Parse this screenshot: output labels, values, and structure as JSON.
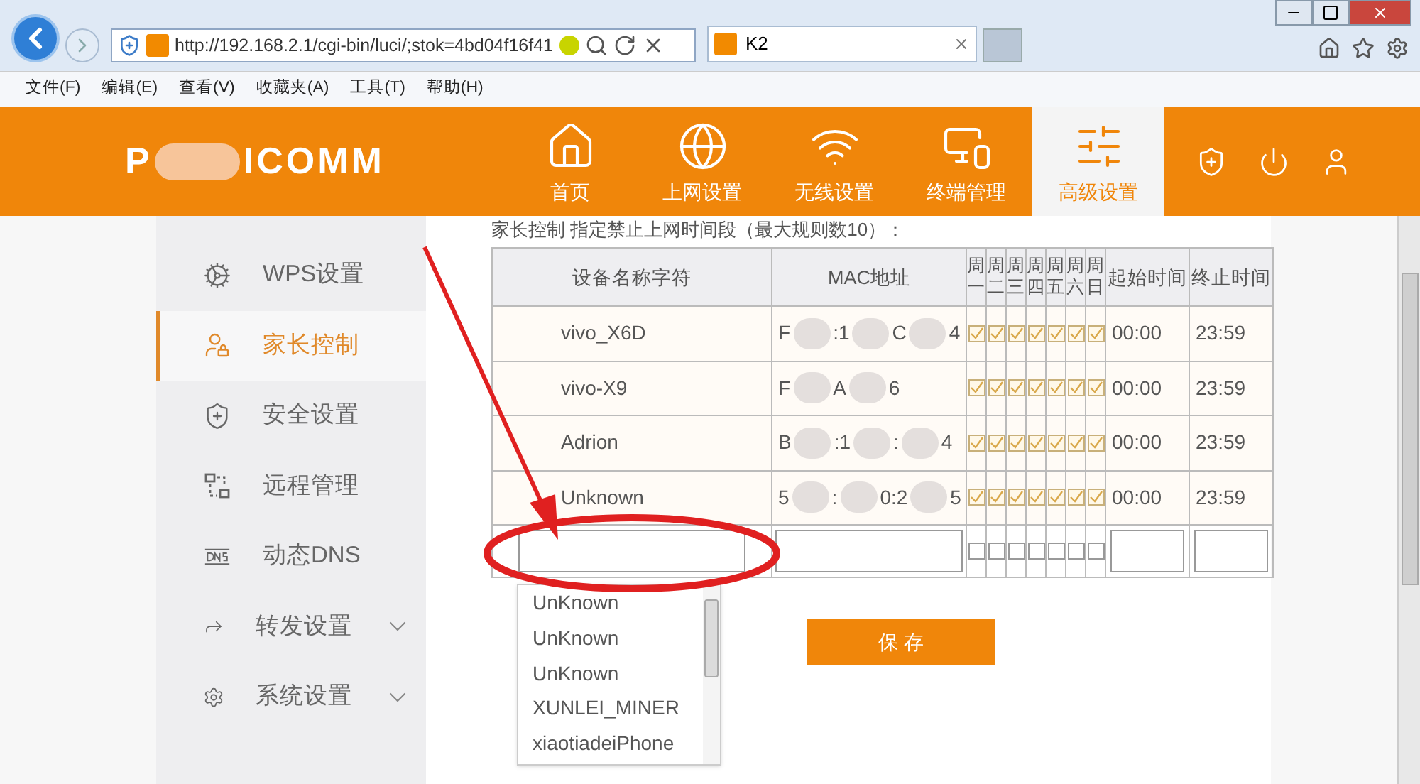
{
  "browser": {
    "url": "http://192.168.2.1/cgi-bin/luci/;stok=4bd04f16f41",
    "tab_title": "K2",
    "menu": [
      "文件(F)",
      "编辑(E)",
      "查看(V)",
      "收藏夹(A)",
      "工具(T)",
      "帮助(H)"
    ]
  },
  "header": {
    "logo_parts": [
      "P",
      "ICOMM"
    ],
    "nav": [
      {
        "label": "首页",
        "selected": false
      },
      {
        "label": "上网设置",
        "selected": false
      },
      {
        "label": "无线设置",
        "selected": false
      },
      {
        "label": "终端管理",
        "selected": false
      },
      {
        "label": "高级设置",
        "selected": true
      }
    ]
  },
  "sidebar": {
    "items": [
      {
        "label": "WPS设置",
        "selected": false,
        "expandable": false
      },
      {
        "label": "家长控制",
        "selected": true,
        "expandable": false
      },
      {
        "label": "安全设置",
        "selected": false,
        "expandable": false
      },
      {
        "label": "远程管理",
        "selected": false,
        "expandable": false
      },
      {
        "label": "动态DNS",
        "selected": false,
        "expandable": false
      },
      {
        "label": "转发设置",
        "selected": false,
        "expandable": true
      },
      {
        "label": "系统设置",
        "selected": false,
        "expandable": true
      }
    ]
  },
  "content": {
    "intro": "家长控制 指定禁止上网时间段（最大规则数10）：",
    "table": {
      "columns": [
        "设备名称字符",
        "MAC地址",
        "周一",
        "周二",
        "周三",
        "周四",
        "周五",
        "周六",
        "周日",
        "起始时间",
        "终止时间"
      ],
      "rows": [
        {
          "device": "vivo_X6D",
          "mac_parts": [
            "F",
            ":1",
            "C",
            "4"
          ],
          "days": [
            true,
            true,
            true,
            true,
            true,
            true,
            true
          ],
          "start": "00:00",
          "end": "23:59"
        },
        {
          "device": "vivo-X9",
          "mac_parts": [
            "F",
            "A",
            "6"
          ],
          "days": [
            true,
            true,
            true,
            true,
            true,
            true,
            true
          ],
          "start": "00:00",
          "end": "23:59"
        },
        {
          "device": "Adrion",
          "mac_parts": [
            "B",
            ":1",
            ":",
            "4"
          ],
          "days": [
            true,
            true,
            true,
            true,
            true,
            true,
            true
          ],
          "start": "00:00",
          "end": "23:59"
        },
        {
          "device": "Unknown",
          "mac_parts": [
            "5",
            ":",
            "0:2",
            "5"
          ],
          "days": [
            true,
            true,
            true,
            true,
            true,
            true,
            true
          ],
          "start": "00:00",
          "end": "23:59"
        }
      ],
      "new_row": {
        "days": [
          false,
          false,
          false,
          false,
          false,
          false,
          false
        ]
      }
    },
    "suggestions": [
      "UnKnown",
      "UnKnown",
      "UnKnown",
      "XUNLEI_MINER",
      "xiaotiadeiPhone"
    ],
    "save_button": "保 存"
  }
}
